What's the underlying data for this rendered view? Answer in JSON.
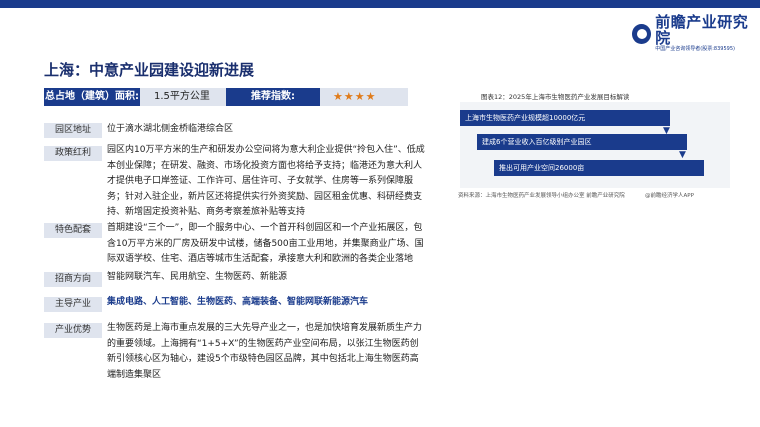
{
  "brand": {
    "name": "前瞻产业研究院",
    "tagline": "中国产业咨询领导者(股票:839595)"
  },
  "page_title": "上海：中意产业园建设迎新进展",
  "info": {
    "area_label": "总占地（建筑）面积:",
    "area_value": "1.5平方公里",
    "rating_label": "推荐指数:",
    "rating_stars": "★★★★",
    "rating_value": 4
  },
  "rows": [
    {
      "label": "园区地址",
      "text": "位于滴水湖北侧金桥临港综合区"
    },
    {
      "label": "政策红利",
      "text": "园区内10万平方米的生产和研发办公空间将为意大利企业提供“拎包入住”、低成本创业保障；在研发、融资、市场化投资方面也将给予支持；临港还为意大利人才提供电子口岸签证、工作许可、居住许可、子女就学、住房等一系列保障服务；针对入驻企业，新片区还将提供实行外资奖励、园区租金优惠、科研经费支持、新增固定投资补贴、商务考察差旅补贴等支持"
    },
    {
      "label": "特色配套",
      "text": "首期建设“三个一”，即一个服务中心、一个首开科创园区和一个产业拓展区，包含10万平方米的厂房及研发中试楼，储备500亩工业用地，并集聚商业广场、国际双语学校、住宅、酒店等城市生活配套，承接意大利和欧洲的各类企业落地"
    },
    {
      "label": "招商方向",
      "text": "智能网联汽车、民用航空、生物医药、新能源"
    },
    {
      "label": "主导产业",
      "text": "集成电路、人工智能、生物医药、高端装备、智能网联新能源汽车"
    },
    {
      "label": "产业优势",
      "text": "生物医药是上海市重点发展的三大先导产业之一，也是加快培育发展新质生产力的重要领域。上海拥有“1+5+X”的生物医药产业空间布局，以张江生物医药创新引领核心区为轴心，建设5个市级特色园区品牌，其中包括北上海生物医药高端制造集聚区"
    }
  ],
  "figure": {
    "caption": "图表12：2025年上海市生物医药产业发展目标解读",
    "bars": [
      {
        "text": "上海市生物医药产业规模超10000亿元"
      },
      {
        "text": "建成6个营业收入百亿级别产业园区"
      },
      {
        "text": "推出可用产业空间26000亩"
      }
    ],
    "source": "资料来源：上海市生物医药产业发展领导小组办公室 前瞻产业研究院",
    "credit": "@前瞻经济学人APP"
  },
  "colors": {
    "primary": "#1a3b8c",
    "label_bg": "#dfe4ee",
    "star": "#e07b1a"
  }
}
